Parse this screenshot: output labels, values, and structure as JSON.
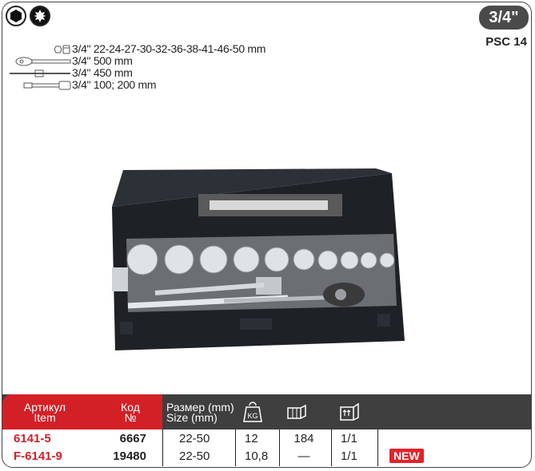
{
  "badge": {
    "size": "3/4\"",
    "model": "PSC 14"
  },
  "specs": [
    {
      "icon": "socket-icon",
      "text": "3/4\" 22-24-27-30-32-36-38-41-46-50 mm"
    },
    {
      "icon": "ratchet-icon",
      "text": "3/4\" 500 mm"
    },
    {
      "icon": "t-bar-icon",
      "text": "3/4\" 450 mm"
    },
    {
      "icon": "extension-bar-icon",
      "text": "3/4\" 100; 200 mm"
    }
  ],
  "table": {
    "headers": {
      "article_ru": "Артикул",
      "article_en": "Item",
      "code_ru": "Код",
      "code_no": "№",
      "size_ru": "Размер (mm)",
      "size_en": "Size (mm)",
      "weight_icon": "KG",
      "box_icon": "box-icon",
      "carton_icon": "carton-icon"
    },
    "rows": [
      {
        "item": "6141-5",
        "code": "6667",
        "size": "22-50",
        "weight": "12",
        "qty": "184",
        "pack": "1/1",
        "badge": ""
      },
      {
        "item": "F-6141-9",
        "code": "19480",
        "size": "22-50",
        "weight": "10,8",
        "qty": "—",
        "pack": "1/1",
        "badge": "NEW"
      }
    ]
  },
  "colors": {
    "accent": "#d32027",
    "header_dark": "#3f3f3f",
    "case": "#1f2329"
  }
}
